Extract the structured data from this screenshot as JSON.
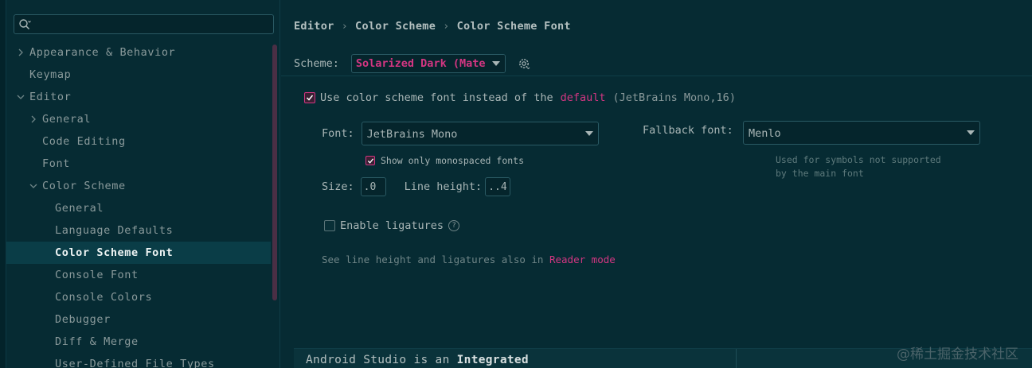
{
  "search": {
    "value": "",
    "placeholder": ""
  },
  "sidebar": {
    "items": [
      {
        "label": "Appearance & Behavior",
        "chevron": "right"
      },
      {
        "label": "Keymap",
        "chevron": ""
      },
      {
        "label": "Editor",
        "chevron": "down"
      },
      {
        "label": "General",
        "chevron": "right"
      },
      {
        "label": "Code Editing",
        "chevron": ""
      },
      {
        "label": "Font",
        "chevron": ""
      },
      {
        "label": "Color Scheme",
        "chevron": "down"
      },
      {
        "label": "General",
        "chevron": ""
      },
      {
        "label": "Language Defaults",
        "chevron": ""
      },
      {
        "label": "Color Scheme Font",
        "chevron": "",
        "selected": true
      },
      {
        "label": "Console Font",
        "chevron": ""
      },
      {
        "label": "Console Colors",
        "chevron": ""
      },
      {
        "label": "Debugger",
        "chevron": ""
      },
      {
        "label": "Diff & Merge",
        "chevron": ""
      },
      {
        "label": "User-Defined File Types",
        "chevron": ""
      }
    ]
  },
  "breadcrumb": [
    "Editor",
    "Color Scheme",
    "Color Scheme Font"
  ],
  "scheme": {
    "label": "Scheme:",
    "value": "Solarized Dark (Mate"
  },
  "use_font": {
    "checked": true,
    "prefix": "Use color scheme font instead of the",
    "link": "default",
    "suffix": "(JetBrains Mono,16)"
  },
  "font": {
    "label": "Font:",
    "value": "JetBrains Mono"
  },
  "monospaced": {
    "checked": true,
    "label": "Show only monospaced fonts"
  },
  "fallback": {
    "label": "Fallback font:",
    "value": "Menlo",
    "hint_line1": "Used for symbols not supported",
    "hint_line2": "by the main font"
  },
  "size": {
    "label": "Size:",
    "value": ".0"
  },
  "line_height": {
    "label": "Line height:",
    "value": "..4"
  },
  "ligatures": {
    "checked": false,
    "label": "Enable ligatures",
    "help": "?"
  },
  "reader": {
    "prefix": "See line height and ligatures also in",
    "link": "Reader mode"
  },
  "preview": {
    "part1": "Android Studio is an",
    "part2": "Integrated"
  },
  "watermark": "@稀土掘金技术社区",
  "colors": {
    "accent": "#d33682",
    "background": "#062b33",
    "selection": "#0a3d47"
  }
}
